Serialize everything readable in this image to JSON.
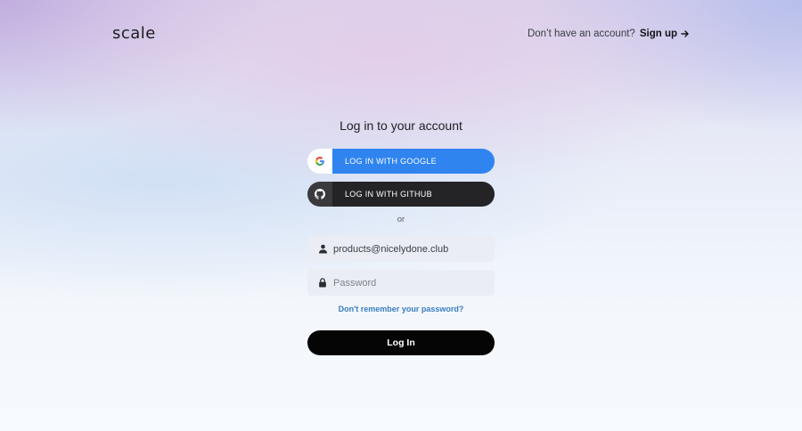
{
  "brand": {
    "logo_text": "scale"
  },
  "header": {
    "prompt": "Don’t have an account?",
    "signup_label": "Sign up",
    "signup_icon": "arrow-right-icon"
  },
  "login": {
    "heading": "Log in to your account",
    "google": {
      "label": "LOG IN WITH GOOGLE",
      "icon": "google-icon",
      "color": "#2f84f0"
    },
    "github": {
      "label": "LOG IN WITH GITHUB",
      "icon": "github-icon",
      "color": "#242427"
    },
    "divider": "or",
    "email": {
      "value": "products@nicelydone.club",
      "icon": "user-icon"
    },
    "password": {
      "placeholder": "Password",
      "icon": "lock-icon"
    },
    "forgot_label": "Don't remember your password?",
    "submit_label": "Log In"
  }
}
